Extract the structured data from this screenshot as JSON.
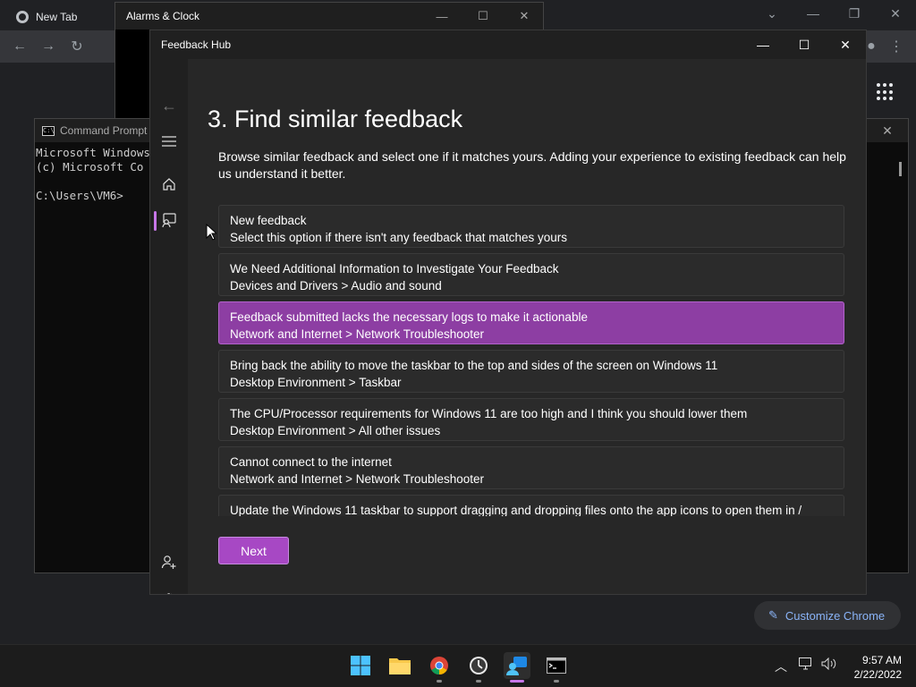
{
  "chrome": {
    "tab_title": "New Tab",
    "customize_label": "Customize Chrome"
  },
  "alarms": {
    "title": "Alarms & Clock"
  },
  "cmd": {
    "title": "Command Prompt",
    "lines": [
      "Microsoft Windows",
      "(c) Microsoft Co",
      "",
      "C:\\Users\\VM6>"
    ]
  },
  "feedback_hub": {
    "title": "Feedback Hub",
    "heading": "3. Find similar feedback",
    "description": "Browse similar feedback and select one if it matches yours. Adding your experience to existing feedback can help us understand it better.",
    "items": [
      {
        "title": "New feedback",
        "subtitle": "Select this option if there isn't any feedback that matches yours",
        "selected": false
      },
      {
        "title": "We Need Additional Information to Investigate Your Feedback",
        "subtitle": "Devices and Drivers > Audio and sound",
        "selected": false
      },
      {
        "title": "Feedback submitted lacks the necessary logs to make it actionable",
        "subtitle": "Network and Internet > Network Troubleshooter",
        "selected": true
      },
      {
        "title": "Bring back the ability to move the taskbar to the top and sides of the screen on Windows 11",
        "subtitle": "Desktop Environment > Taskbar",
        "selected": false
      },
      {
        "title": "The CPU/Processor requirements for Windows 11 are too high and I think you should lower them",
        "subtitle": "Desktop Environment > All other issues",
        "selected": false
      },
      {
        "title": "Cannot connect to the internet",
        "subtitle": "Network and Internet > Network Troubleshooter",
        "selected": false
      },
      {
        "title": "Update the Windows 11 taskbar to support dragging and dropping files onto the app icons to open them in /",
        "subtitle": "",
        "selected": false
      }
    ],
    "next_label": "Next",
    "accent_color": "#a748c4"
  },
  "taskbar": {
    "time": "9:57 AM",
    "date": "2/22/2022"
  }
}
